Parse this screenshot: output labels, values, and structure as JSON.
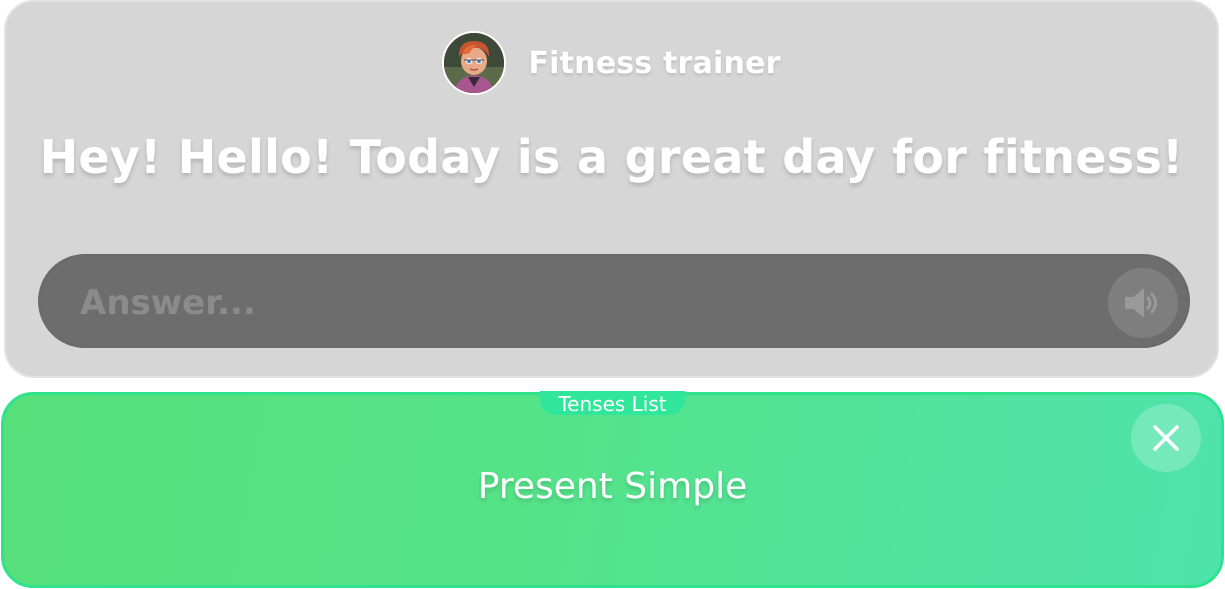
{
  "trainer": {
    "name": "Fitness trainer",
    "avatar_icon": "trainer-avatar"
  },
  "message": {
    "text": "Hey! Hello! Today is a great day for fitness!"
  },
  "answer": {
    "placeholder": "Answer...",
    "value": "",
    "sound_icon": "speaker-icon"
  },
  "tenses": {
    "tab_label": "Tenses List",
    "current": "Present Simple",
    "close_icon": "close-icon"
  },
  "colors": {
    "top_panel_bg": "#d6d6d6",
    "answer_bar_bg": "#6d6d6d",
    "bottom_panel_start": "#57e07a",
    "bottom_panel_end": "#4fe3ad",
    "bottom_panel_border": "#2fe38e",
    "tab_bg": "#2fe69a"
  }
}
